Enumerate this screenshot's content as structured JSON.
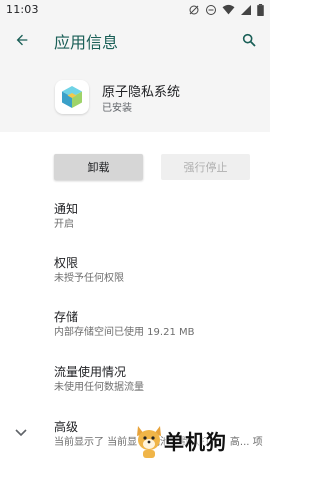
{
  "status_bar": {
    "time": "11:03"
  },
  "app_bar": {
    "title": "应用信息"
  },
  "app": {
    "name": "原子隐私系统",
    "status": "已安装"
  },
  "actions": {
    "uninstall": "卸载",
    "force_stop": "强行停止"
  },
  "settings": [
    {
      "title": "通知",
      "subtitle": "开启"
    },
    {
      "title": "权限",
      "subtitle": "未授予任何权限"
    },
    {
      "title": "存储",
      "subtitle": "内部存储空间已使用 19.21 MB"
    },
    {
      "title": "流量使用情况",
      "subtitle": "未使用任何数据流量"
    },
    {
      "title": "高级",
      "subtitle": "当前显示了  当前显   ...电池、默认打开、高... 项"
    }
  ],
  "watermark": {
    "text": "单机狗"
  },
  "colors": {
    "accent": "#1a5f57",
    "background": "#f5f5f5"
  }
}
